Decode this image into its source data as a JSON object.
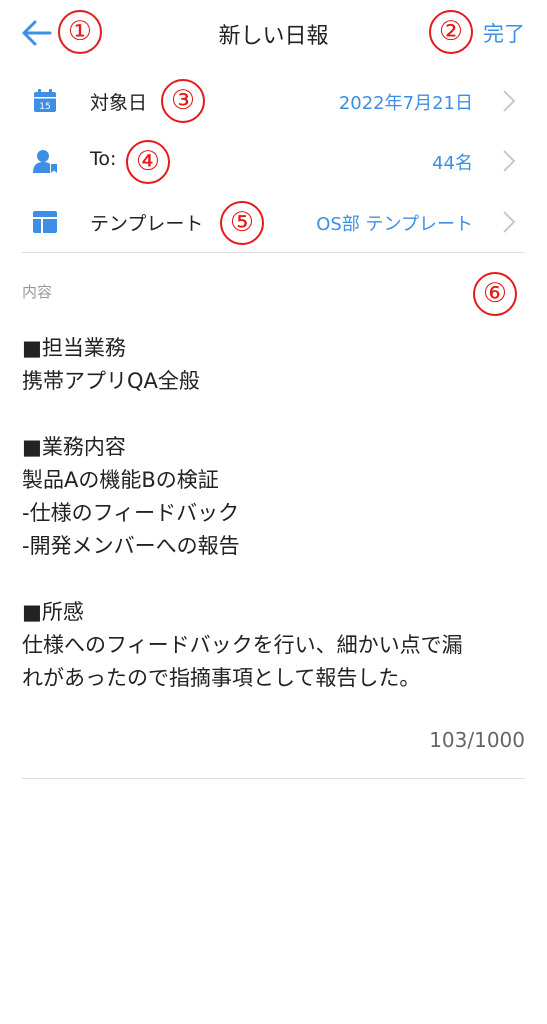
{
  "header": {
    "title": "新しい日報",
    "done_label": "完了"
  },
  "markers": [
    "①",
    "②",
    "③",
    "④",
    "⑤",
    "⑥"
  ],
  "fields": {
    "date": {
      "label": "対象日",
      "value": "2022年7月21日",
      "icon_day": "15"
    },
    "to": {
      "label": "To:",
      "value": "44名"
    },
    "template": {
      "label": "テンプレート",
      "value": "OS部 テンプレート"
    }
  },
  "content": {
    "label": "内容",
    "text": "■担当業務\n携帯アプリQA全般\n\n■業務内容\n製品Aの機能Bの検証\n-仕様のフィードバック\n-開発メンバーへの報告\n\n■所感\n仕様へのフィードバックを行い、細かい点で漏\nれがあったので指摘事項として報告した。",
    "counter": "103/1000"
  },
  "colors": {
    "accent": "#3d8fe6",
    "marker": "#e31b1b",
    "divider": "#dddddd"
  },
  "icons": {
    "back": "arrow-left-icon",
    "date": "calendar-icon",
    "to": "person-icon",
    "template": "template-icon",
    "chevron": "chevron-right-icon"
  }
}
